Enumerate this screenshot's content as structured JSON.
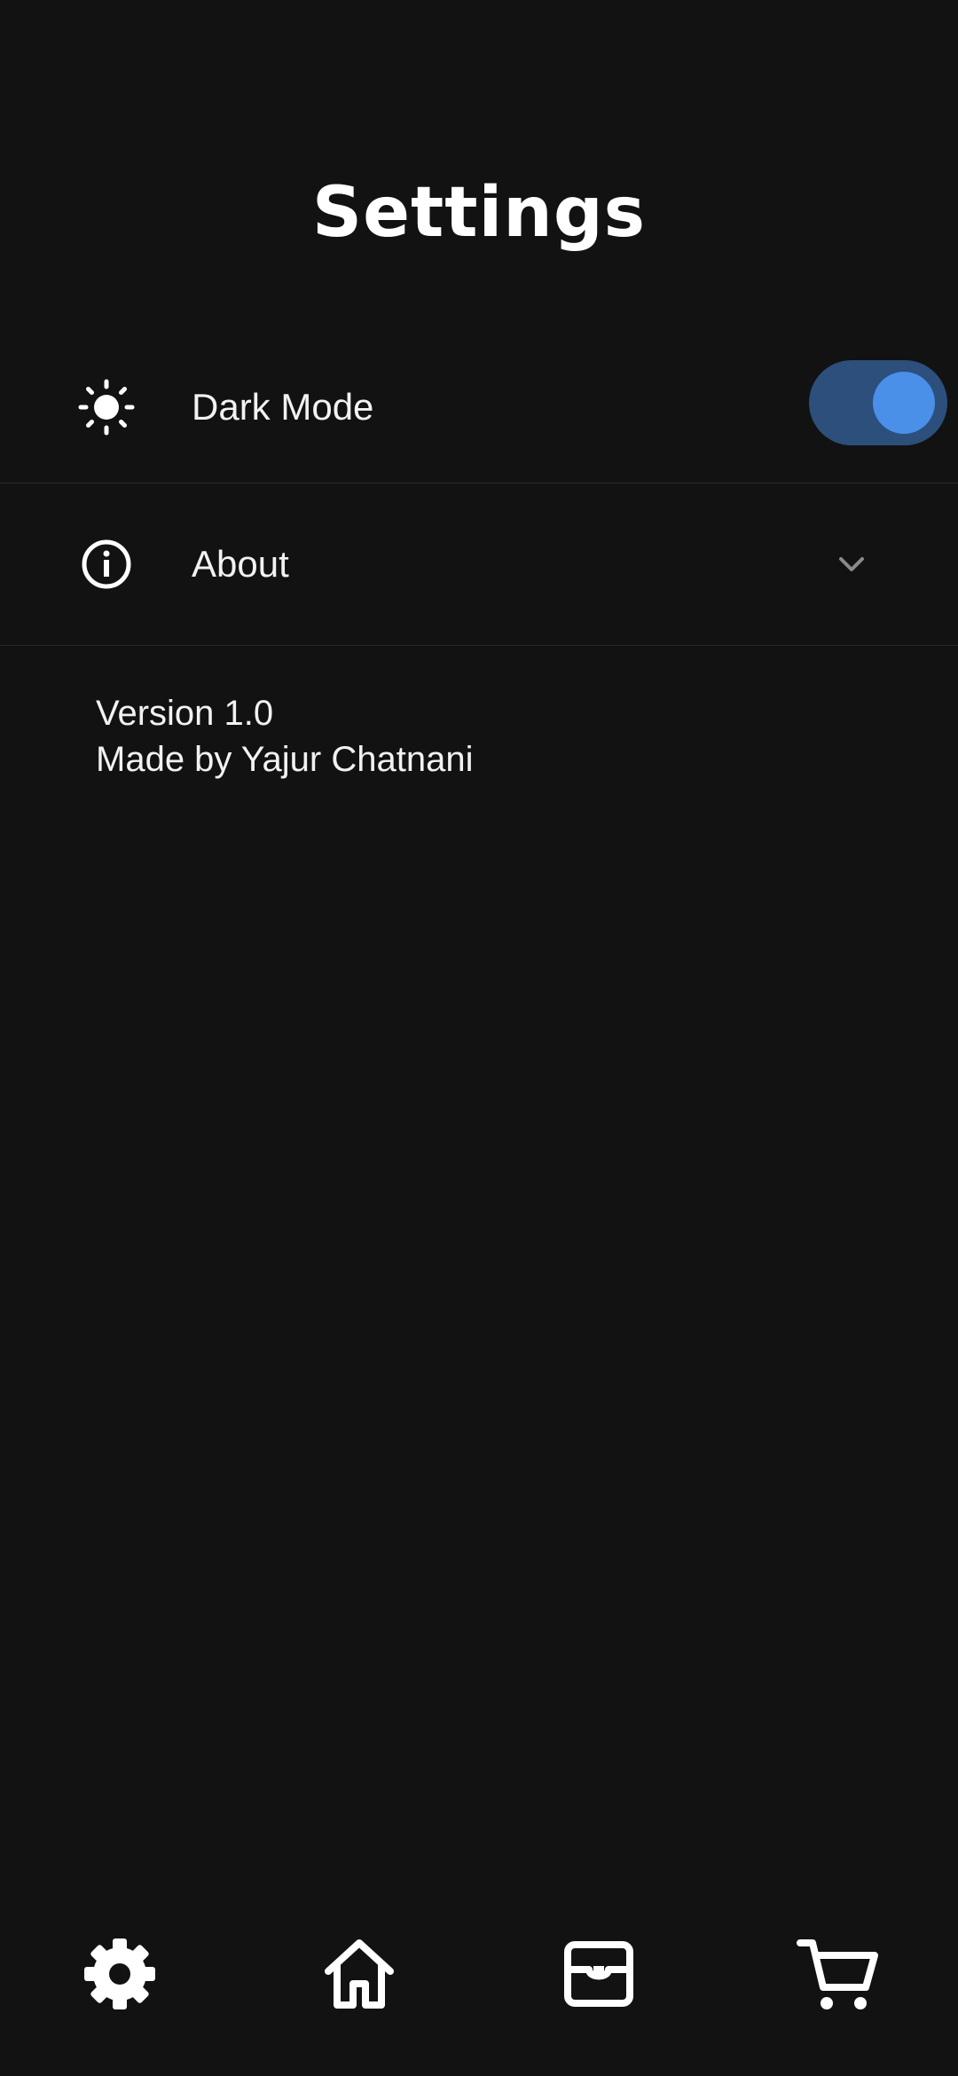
{
  "header": {
    "title": "Settings"
  },
  "settings": {
    "dark_mode": {
      "label": "Dark Mode",
      "enabled": true,
      "icon": "sun-icon"
    },
    "about": {
      "label": "About",
      "icon": "info-icon",
      "expanded": true,
      "version": "Version 1.0",
      "author": "Made by Yajur Chatnani"
    }
  },
  "bottom_nav": {
    "items": [
      {
        "icon": "gear-icon"
      },
      {
        "icon": "home-icon"
      },
      {
        "icon": "inbox-icon"
      },
      {
        "icon": "cart-icon"
      }
    ]
  },
  "colors": {
    "background": "#121212",
    "toggle_track": "#2c4f7c",
    "toggle_knob": "#4a8fe8",
    "text": "#ffffff"
  }
}
